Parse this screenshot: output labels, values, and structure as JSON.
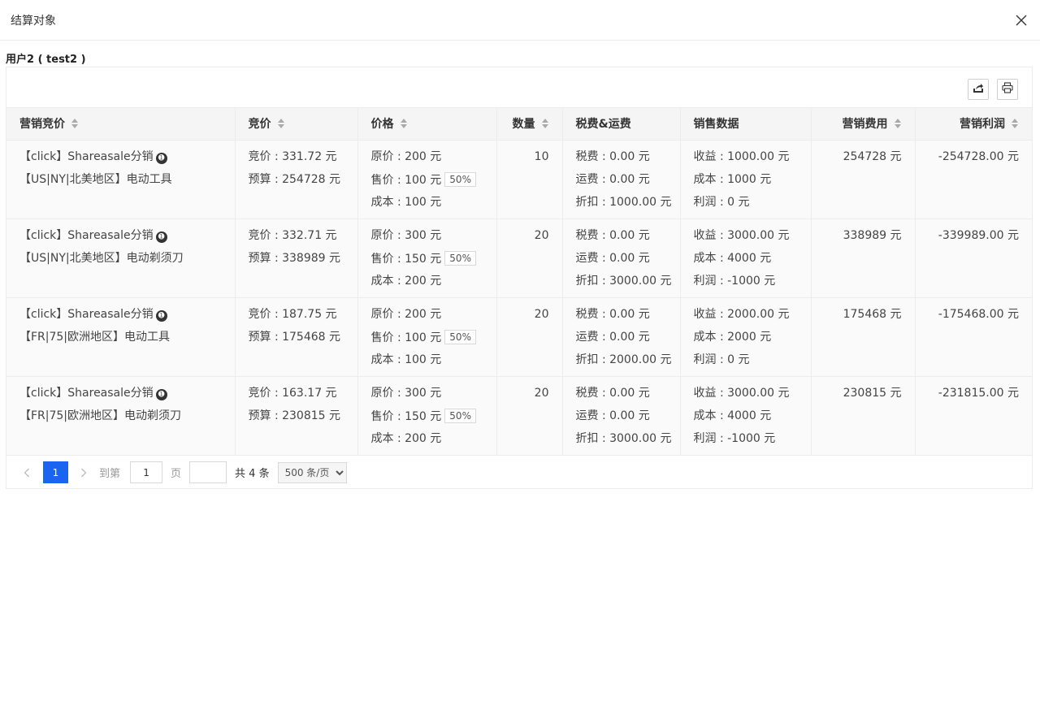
{
  "dialog": {
    "title": "结算对象"
  },
  "subject": "用户2 ( test2 )",
  "columns": [
    "营销竞价",
    "竞价",
    "价格",
    "数量",
    "税费&运费",
    "销售数据",
    "营销费用",
    "营销利润"
  ],
  "rows": [
    {
      "campaign": "【click】Shareasale分销",
      "info_icon": "➊",
      "target": "【US|NY|北美地区】电动工具",
      "bid": "竞价 : 331.72 元",
      "budget": "预算 : 254728 元",
      "orig_price": "原价 : 200 元",
      "sale_price": "售价 : 100 元",
      "discount_tag": "50%",
      "cost_price": "成本 : 100 元",
      "qty": "10",
      "tax": "税费 : 0.00 元",
      "shipping": "运费 : 0.00 元",
      "rebate": "折扣 : 1000.00 元",
      "revenue": "收益 : 1000.00 元",
      "cost": "成本 : 1000 元",
      "profit": "利润 : 0 元",
      "marketing_cost": "254728 元",
      "marketing_profit": "-254728.00 元"
    },
    {
      "campaign": "【click】Shareasale分销",
      "info_icon": "➊",
      "target": "【US|NY|北美地区】电动剃须刀",
      "bid": "竞价 : 332.71 元",
      "budget": "预算 : 338989 元",
      "orig_price": "原价 : 300 元",
      "sale_price": "售价 : 150 元",
      "discount_tag": "50%",
      "cost_price": "成本 : 200 元",
      "qty": "20",
      "tax": "税费 : 0.00 元",
      "shipping": "运费 : 0.00 元",
      "rebate": "折扣 : 3000.00 元",
      "revenue": "收益 : 3000.00 元",
      "cost": "成本 : 4000 元",
      "profit": "利润 : -1000 元",
      "marketing_cost": "338989 元",
      "marketing_profit": "-339989.00 元"
    },
    {
      "campaign": "【click】Shareasale分销",
      "info_icon": "➊",
      "target": "【FR|75|欧洲地区】电动工具",
      "bid": "竞价 : 187.75 元",
      "budget": "预算 : 175468 元",
      "orig_price": "原价 : 200 元",
      "sale_price": "售价 : 100 元",
      "discount_tag": "50%",
      "cost_price": "成本 : 100 元",
      "qty": "20",
      "tax": "税费 : 0.00 元",
      "shipping": "运费 : 0.00 元",
      "rebate": "折扣 : 2000.00 元",
      "revenue": "收益 : 2000.00 元",
      "cost": "成本 : 2000 元",
      "profit": "利润 : 0 元",
      "marketing_cost": "175468 元",
      "marketing_profit": "-175468.00 元"
    },
    {
      "campaign": "【click】Shareasale分销",
      "info_icon": "➊",
      "target": "【FR|75|欧洲地区】电动剃须刀",
      "bid": "竞价 : 163.17 元",
      "budget": "预算 : 230815 元",
      "orig_price": "原价 : 300 元",
      "sale_price": "售价 : 150 元",
      "discount_tag": "50%",
      "cost_price": "成本 : 200 元",
      "qty": "20",
      "tax": "税费 : 0.00 元",
      "shipping": "运费 : 0.00 元",
      "rebate": "折扣 : 3000.00 元",
      "revenue": "收益 : 3000.00 元",
      "cost": "成本 : 4000 元",
      "profit": "利润 : -1000 元",
      "marketing_cost": "230815 元",
      "marketing_profit": "-231815.00 元"
    }
  ],
  "pagination": {
    "current_page": "1",
    "goto_label": "到第",
    "goto_value": "1",
    "page_label": "页",
    "page_input": "",
    "total": "共 4 条",
    "page_size": "500 条/页"
  },
  "icons": {
    "close": "close-icon",
    "export": "export-icon",
    "print": "print-icon",
    "prev": "chevron-left-icon",
    "next": "chevron-right-icon"
  },
  "colors": {
    "primary": "#1a64f0",
    "header_bg": "#f5f5f5",
    "row_bg": "#fafafa"
  }
}
